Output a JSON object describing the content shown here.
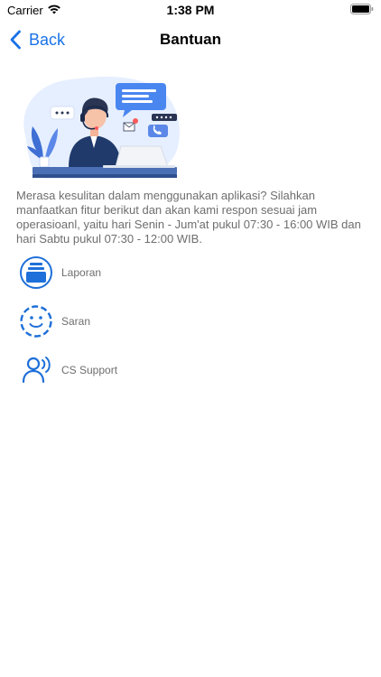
{
  "status_bar": {
    "carrier": "Carrier",
    "time": "1:38 PM"
  },
  "nav": {
    "back_label": "Back",
    "title": "Bantuan"
  },
  "description": "Merasa kesulitan dalam menggunakan aplikasi? Silahkan manfaatkan fitur berikut dan akan kami respon sesuai jam operasioanl, yaitu hari Senin - Jum'at pukul 07:30 - 16:00 WIB dan hari Sabtu pukul 07:30 - 12:00 WIB.",
  "menu": [
    {
      "label": "Laporan",
      "icon": "report-icon"
    },
    {
      "label": "Saran",
      "icon": "smiley-icon"
    },
    {
      "label": "CS Support",
      "icon": "cs-support-icon"
    }
  ],
  "colors": {
    "accent": "#1a73e8",
    "icon_blue": "#1e6fd9",
    "text_muted": "#6e6e6e"
  }
}
